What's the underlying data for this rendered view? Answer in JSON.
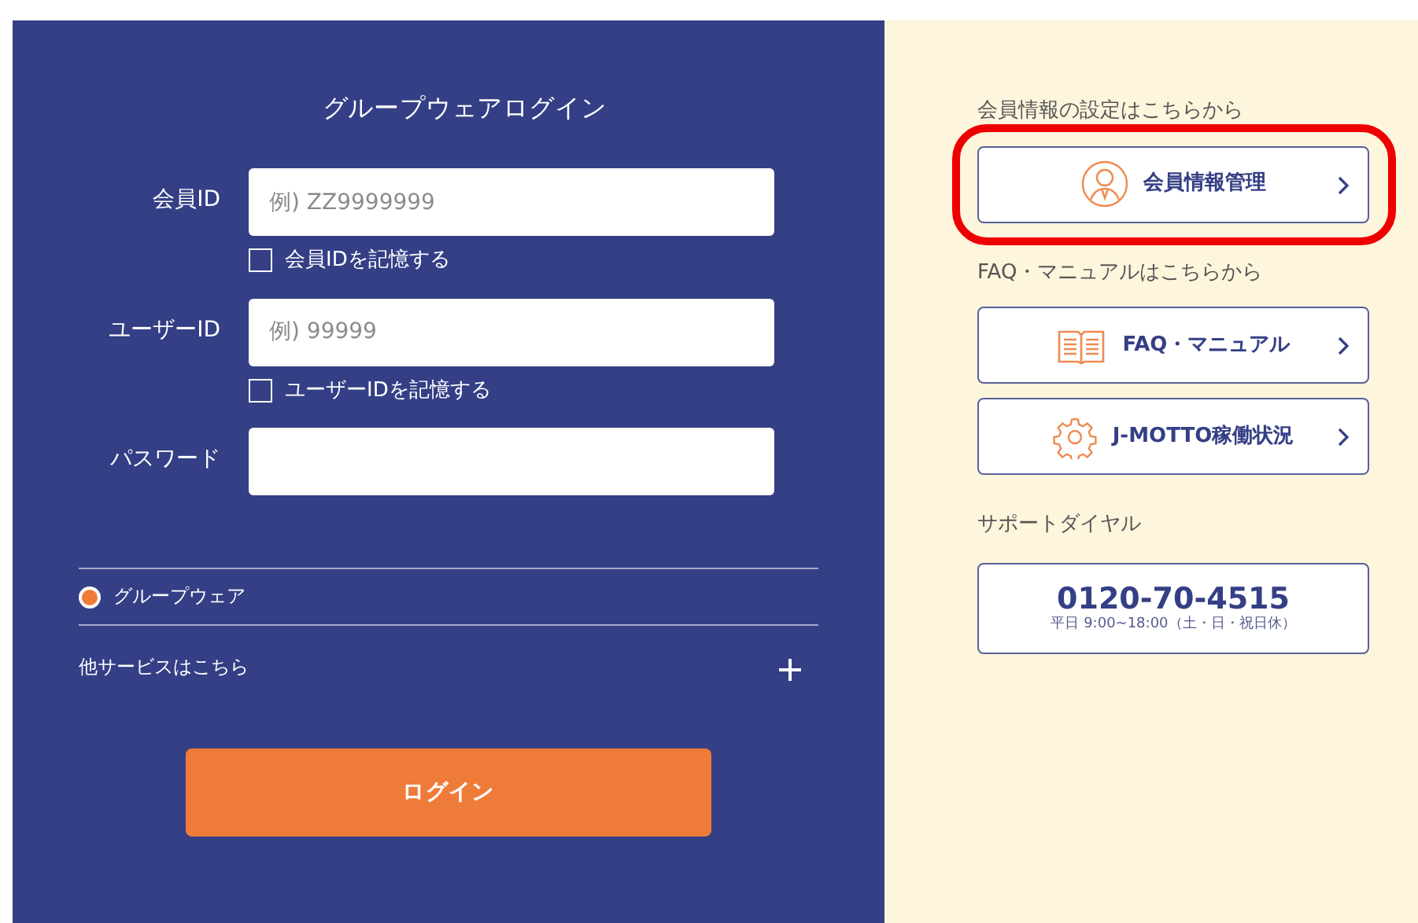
{
  "login": {
    "title": "グループウェアログイン",
    "fields": [
      {
        "label": "会員ID",
        "placeholder": "例) ZZ9999999",
        "remember": {
          "label": "会員IDを記憶する",
          "checked": false
        }
      },
      {
        "label": "ユーザーID",
        "placeholder": "例) 99999",
        "remember": {
          "label": "ユーザーIDを記憶する",
          "checked": false
        }
      },
      {
        "label": "パスワード"
      }
    ],
    "services": [
      {
        "label": "グループウェア",
        "selected": true
      }
    ],
    "other_services": {
      "label": "他サービスはこちら",
      "expanded": false
    },
    "submit": "ログイン"
  },
  "side": {
    "sections": [
      {
        "heading": "会員情報の設定はこちらから",
        "buttons": [
          {
            "kind": "person",
            "label": "会員情報管理",
            "highlighted": true
          }
        ]
      },
      {
        "heading": "FAQ・マニュアルはこちらから",
        "buttons": [
          {
            "kind": "book",
            "label": "FAQ・マニュアル",
            "highlighted": false
          },
          {
            "kind": "gear",
            "label": "J-MOTTO稼働状況",
            "highlighted": false
          }
        ]
      },
      {
        "heading": "サポートダイヤル",
        "phone": {
          "number": "0120-70-4515",
          "hours": "平日 9:00~18:00（土・日・祝日休）"
        }
      }
    ]
  }
}
